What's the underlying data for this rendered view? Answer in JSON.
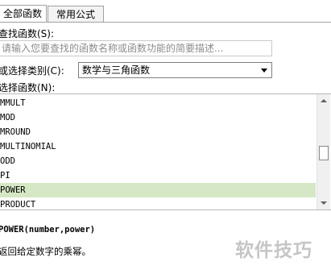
{
  "tabs": [
    {
      "label": "全部函数"
    },
    {
      "label": "常用公式"
    }
  ],
  "search": {
    "label": "查找函数(S):",
    "placeholder": "请输入您要查找的函数名称或函数功能的简要描述..."
  },
  "category": {
    "label": "或选择类别(C):",
    "selected": "数学与三角函数"
  },
  "function_list": {
    "label": "选择函数(N):",
    "items": [
      "MMULT",
      "MOD",
      "MROUND",
      "MULTINOMIAL",
      "ODD",
      "PI",
      "POWER",
      "PRODUCT"
    ],
    "selected_index": 6
  },
  "signature": "POWER(number,power)",
  "description": "返回给定数字的乘幂。",
  "watermark": "软件技巧",
  "colors": {
    "selection": "#d5e7c4",
    "border": "#a0a0a0"
  }
}
